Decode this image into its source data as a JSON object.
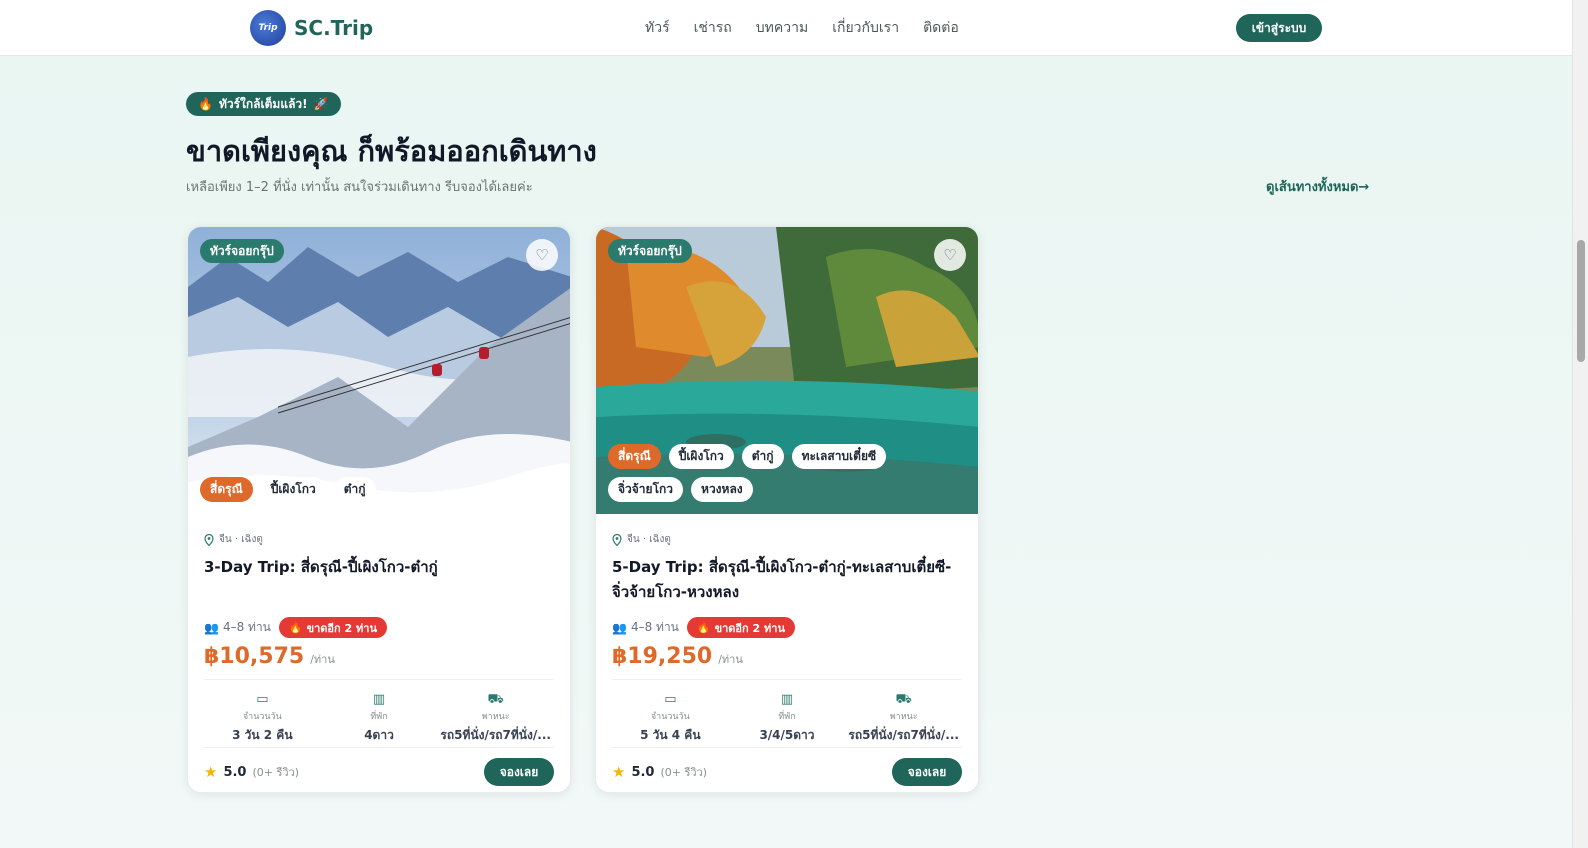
{
  "header": {
    "logo_mark": "Trip",
    "brand": "SC.Trip",
    "nav": [
      "ทัวร์",
      "เช่ารถ",
      "บทความ",
      "เกี่ยวกับเรา",
      "ติดต่อ"
    ],
    "login": "เข้าสู่ระบบ"
  },
  "section": {
    "badge": "ทัวร์ใกล้เต็มแล้ว!",
    "title": "ขาดเพียงคุณ ก็พร้อมออกเดินทาง",
    "subtitle": "เหลือเพียง 1–2 ที่นั่ง เท่านั้น สนใจร่วมเดินทาง รีบจองได้เลยค่ะ",
    "see_all": "ดูเส้นทางทั้งหมด→"
  },
  "cards": [
    {
      "type": "ทัวร์จอยกรุ๊ป",
      "tags": [
        "สี่ดรุณี",
        "ปี้เผิงโกว",
        "ต๋ากู่"
      ],
      "location": "จีน · เฉิงตู",
      "name": "3-Day Trip: สี่ดรุณี-ปี้เผิงโกว-ต๋ากู่",
      "pax": "4–8 ท่าน",
      "short": "ขาดอีก 2 ท่าน",
      "price": "฿10,575",
      "per": "/ท่าน",
      "specs": [
        {
          "icon": "calendar-icon",
          "label": "จำนวนวัน",
          "value": "3 วัน 2 คืน"
        },
        {
          "icon": "building-icon",
          "label": "ที่พัก",
          "value": "4ดาว"
        },
        {
          "icon": "vehicle-icon",
          "label": "พาหนะ",
          "value": "รถ5ที่นั่ง/รถ7ที่นั่ง/..."
        }
      ],
      "rating": "5.0",
      "reviews": "(0+ รีวิว)",
      "book": "จองเลย"
    },
    {
      "type": "ทัวร์จอยกรุ๊ป",
      "tags": [
        "สี่ดรุณี",
        "ปี้เผิงโกว",
        "ต๋ากู่",
        "ทะเลสาบเตี๋ยซี",
        "จิ่วจ้ายโกว",
        "หวงหลง"
      ],
      "location": "จีน · เฉิงตู",
      "name": "5-Day Trip: สี่ดรุณี-ปี้เผิงโกว-ต๋ากู่-ทะเลสาบเตี๋ยซี-จิ่วจ้ายโกว-หวงหลง",
      "pax": "4–8 ท่าน",
      "short": "ขาดอีก 2 ท่าน",
      "price": "฿19,250",
      "per": "/ท่าน",
      "specs": [
        {
          "icon": "calendar-icon",
          "label": "จำนวนวัน",
          "value": "5 วัน 4 คืน"
        },
        {
          "icon": "building-icon",
          "label": "ที่พัก",
          "value": "3/4/5ดาว"
        },
        {
          "icon": "vehicle-icon",
          "label": "พาหนะ",
          "value": "รถ5ที่นั่ง/รถ7ที่นั่ง/..."
        }
      ],
      "rating": "5.0",
      "reviews": "(0+ รีวิว)",
      "book": "จองเลย"
    }
  ],
  "colors": {
    "brand": "#20655a",
    "price": "#dd6a2a",
    "alert": "#e53935"
  }
}
